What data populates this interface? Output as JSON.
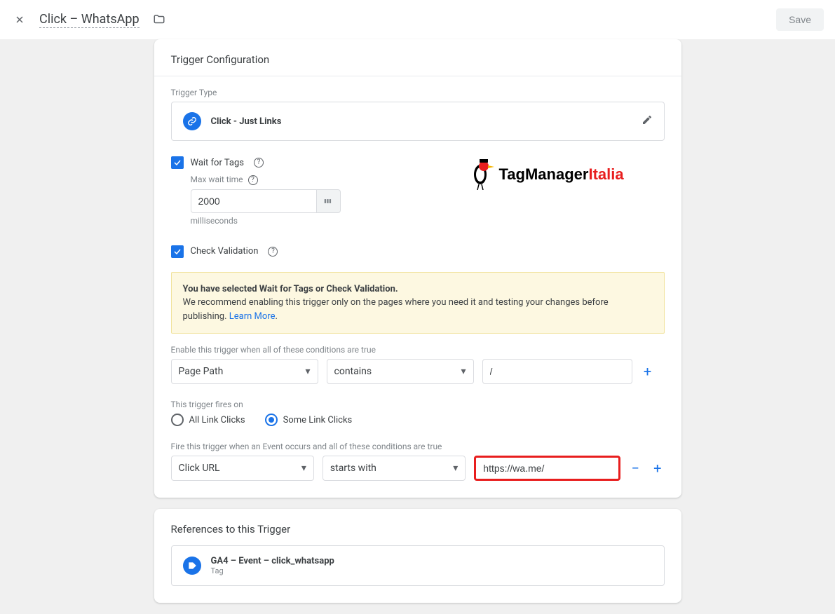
{
  "header": {
    "title": "Click – WhatsApp",
    "save_label": "Save"
  },
  "config": {
    "card_title": "Trigger Configuration",
    "trigger_type_label": "Trigger Type",
    "trigger_type_name": "Click - Just Links",
    "wait_for_tags_label": "Wait for Tags",
    "max_wait_label": "Max wait time",
    "max_wait_value": "2000",
    "max_wait_unit": "milliseconds",
    "check_validation_label": "Check Validation",
    "notice_bold": "You have selected Wait for Tags or Check Validation.",
    "notice_body": "We recommend enabling this trigger only on the pages where you need it and testing your changes before publishing. ",
    "notice_link": "Learn More",
    "enable_cond_label": "Enable this trigger when all of these conditions are true",
    "enable_cond": {
      "var": "Page Path",
      "op": "contains",
      "val": "/"
    },
    "fires_on_label": "This trigger fires on",
    "fires_on": {
      "all": "All Link Clicks",
      "some": "Some Link Clicks"
    },
    "fire_cond_label": "Fire this trigger when an Event occurs and all of these conditions are true",
    "fire_cond": {
      "var": "Click URL",
      "op": "starts with",
      "val": "https://wa.me/"
    }
  },
  "references": {
    "card_title": "References to this Trigger",
    "items": [
      {
        "name": "GA4 – Event – click_whatsapp",
        "sub": "Tag"
      }
    ]
  },
  "watermark": {
    "a": "TagManager",
    "b": "Italia"
  }
}
